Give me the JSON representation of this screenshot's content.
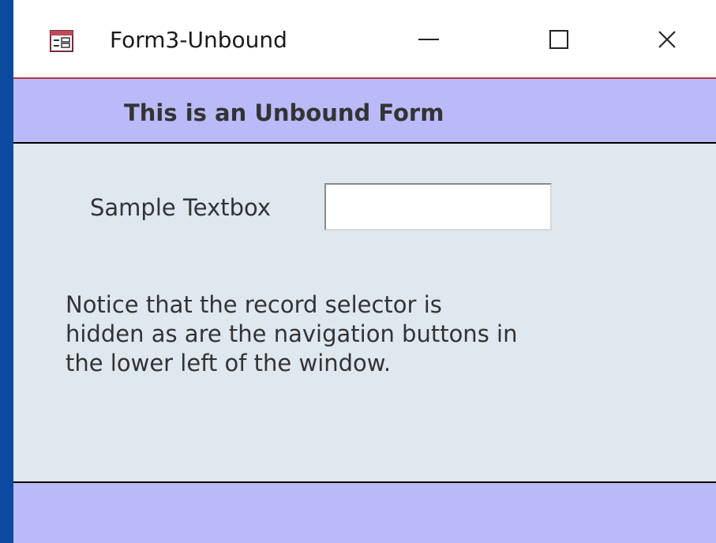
{
  "window": {
    "title": "Form3-Unbound",
    "icon": "form-icon",
    "controls": {
      "minimize_icon": "minimize-icon",
      "maximize_icon": "maximize-icon",
      "close_icon": "close-icon"
    }
  },
  "form": {
    "header_title": "This is an Unbound Form",
    "sample_label": "Sample Textbox",
    "sample_value": "",
    "note_lines": [
      "Notice that the record selector is",
      "hidden as are the navigation buttons in",
      "the lower left of the window."
    ]
  },
  "colors": {
    "header_bg": "#babaf8",
    "detail_bg": "#dfe7ef",
    "desktop_bg": "#0b4aa0",
    "title_border": "#b03a3a"
  }
}
